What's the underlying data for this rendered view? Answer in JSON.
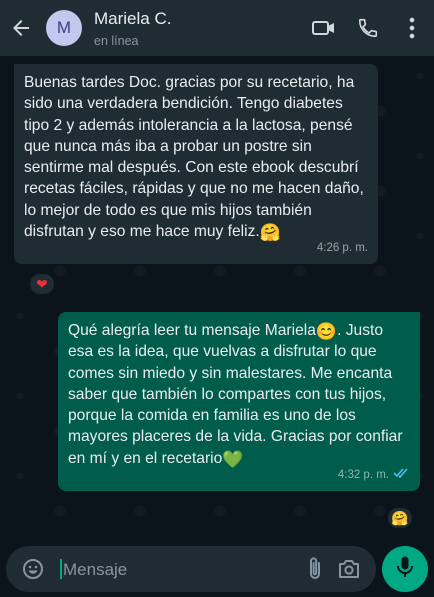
{
  "header": {
    "avatar_letter": "M",
    "contact_name": "Mariela C.",
    "status": "en línea"
  },
  "messages": [
    {
      "direction": "incoming",
      "text": "Buenas tardes Doc. gracias por su recetario, ha sido una verdadera bendición. Tengo diabetes tipo 2 y además intolerancia a la lactosa, pensé que nunca más iba a probar un postre sin sentirme mal después. Con este ebook descubrí recetas fáciles, rápidas y que no me hacen daño, lo mejor de todo es que mis hijos también disfrutan y eso me hace muy feliz.",
      "emoji": "🤗",
      "time": "4:26 p. m.",
      "reaction": "❤"
    },
    {
      "direction": "outgoing",
      "text_part1": "Qué alegría leer tu mensaje Mariela",
      "emoji1": "😊",
      "text_part2": ". Justo esa es la idea, que vuelvas a disfrutar lo que comes sin miedo y sin malestares. Me encanta saber que también lo compartes con tus hijos, porque la comida en familia es uno de los mayores placeres de la vida. Gracias por confiar en mí y en el recetario",
      "emoji2": "💚",
      "time": "4:32 p. m.",
      "status": "read",
      "reaction": "🤗"
    }
  ],
  "composer": {
    "placeholder": "Mensaje"
  },
  "colors": {
    "header_bg": "#1f2c34",
    "chat_bg": "#0b141a",
    "incoming_bubble": "#1f2c34",
    "outgoing_bubble": "#005c4b",
    "accent": "#00a884",
    "read_ticks": "#53bdeb"
  },
  "icons": [
    "back-arrow-icon",
    "video-call-icon",
    "phone-icon",
    "more-vert-icon",
    "emoji-icon",
    "attach-icon",
    "camera-icon",
    "mic-icon",
    "read-ticks-icon"
  ]
}
